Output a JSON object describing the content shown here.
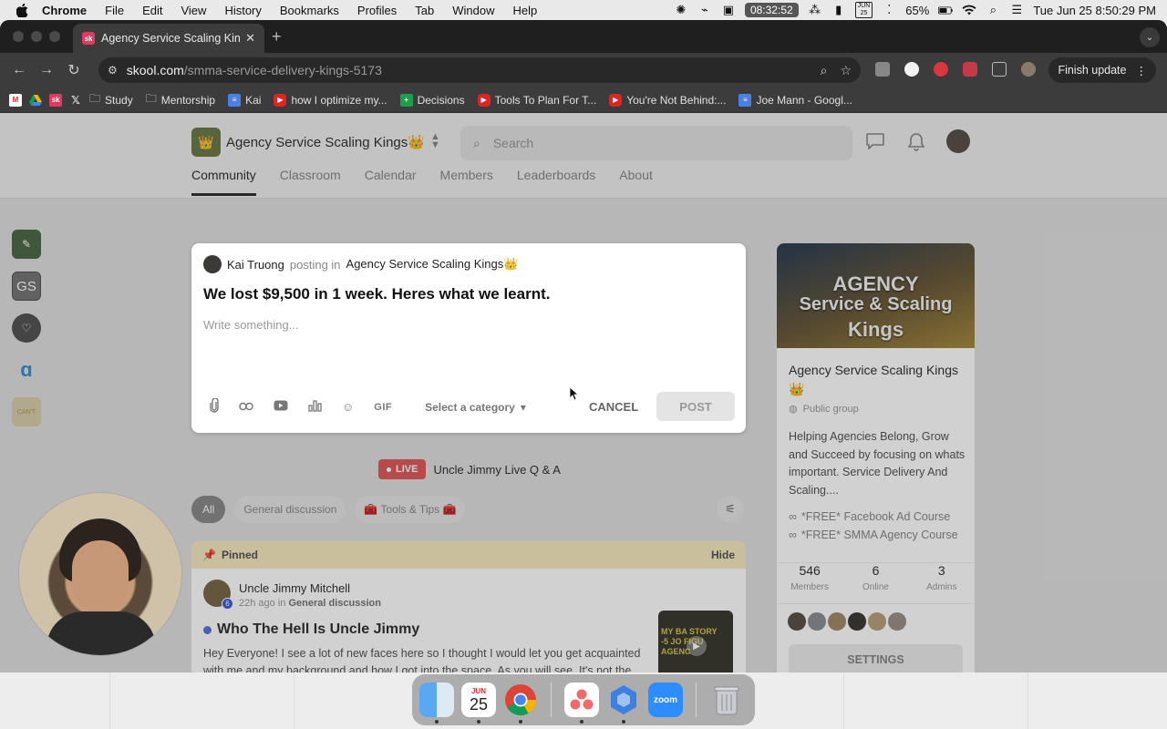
{
  "menubar": {
    "app": "Chrome",
    "items": [
      "File",
      "Edit",
      "View",
      "History",
      "Bookmarks",
      "Profiles",
      "Tab",
      "Window",
      "Help"
    ],
    "timer": "08:32:52",
    "cal_month": "JUN",
    "cal_day": "25",
    "battery": "65%",
    "datetime": "Tue Jun 25  8:50:29 PM"
  },
  "browser": {
    "tab_title": "Agency Service Scaling Kings",
    "tab_favicon": "sk",
    "url_host": "skool.com",
    "url_path": "/smma-service-delivery-kings-5173",
    "finish_update": "Finish update",
    "bookmarks": [
      {
        "label": "Study",
        "icon": "folder-icon"
      },
      {
        "label": "Mentorship",
        "icon": "folder-icon"
      },
      {
        "label": "Kai",
        "icon": "docs-icon"
      },
      {
        "label": "how I optimize my...",
        "icon": "youtube-icon"
      },
      {
        "label": "Decisions",
        "icon": "sheets-icon"
      },
      {
        "label": "Tools To Plan For T...",
        "icon": "youtube-icon"
      },
      {
        "label": "You're Not Behind:...",
        "icon": "youtube-icon"
      },
      {
        "label": "Joe Mann - Googl...",
        "icon": "docs-icon"
      }
    ]
  },
  "header": {
    "group_name": "Agency Service Scaling Kings👑",
    "search_placeholder": "Search",
    "tabs": [
      "Community",
      "Classroom",
      "Calendar",
      "Members",
      "Leaderboards",
      "About"
    ],
    "active_tab": "Community"
  },
  "rail": {
    "gs_label": "GS",
    "can_label": "CAN'T"
  },
  "composer": {
    "author": "Kai Truong",
    "posting_in": "posting in",
    "group": "Agency Service Scaling Kings👑",
    "title": "We lost $9,500 in 1 week. Heres what we learnt.",
    "body_placeholder": "Write something...",
    "gif_label": "GIF",
    "category_label": "Select a category",
    "cancel_label": "CANCEL",
    "post_label": "POST"
  },
  "live": {
    "badge": "LIVE",
    "title": "Uncle Jimmy Live Q & A"
  },
  "filters": {
    "all": "All",
    "general": "General discussion",
    "tools": "🧰 Tools & Tips 🧰"
  },
  "pinned": {
    "label": "Pinned",
    "hide": "Hide",
    "author": "Uncle Jimmy Mitchell",
    "level": "6",
    "time": "22h ago",
    "in_label": "in",
    "category": "General discussion",
    "title": "Who The Hell Is Uncle Jimmy",
    "body": "Hey Everyone! I see a lot of new faces here so I thought I would let you get acquainted with me and my background and how I got into the space. As you will see, It's not the",
    "thumb_text_1": "MY BA STORY",
    "thumb_text_2": "-5 JO",
    "thumb_text_3": "FIGU AGENC"
  },
  "about": {
    "cover_line1": "AGENCY",
    "cover_line2": "Service & Scaling",
    "cover_line3": "Kings",
    "name": "Agency Service Scaling Kings 👑",
    "visibility": "Public group",
    "description": "Helping Agencies Belong, Grow and Succeed by focusing on whats important. Service Delivery And Scaling....",
    "links": [
      "*FREE* Facebook Ad Course",
      "*FREE* SMMA Agency Course"
    ],
    "stats": [
      {
        "value": "546",
        "label": "Members"
      },
      {
        "value": "6",
        "label": "Online"
      },
      {
        "value": "3",
        "label": "Admins"
      }
    ],
    "settings_label": "SETTINGS"
  },
  "dock": {
    "cal_month": "JUN",
    "cal_day": "25",
    "zoom_label": "zoom"
  }
}
